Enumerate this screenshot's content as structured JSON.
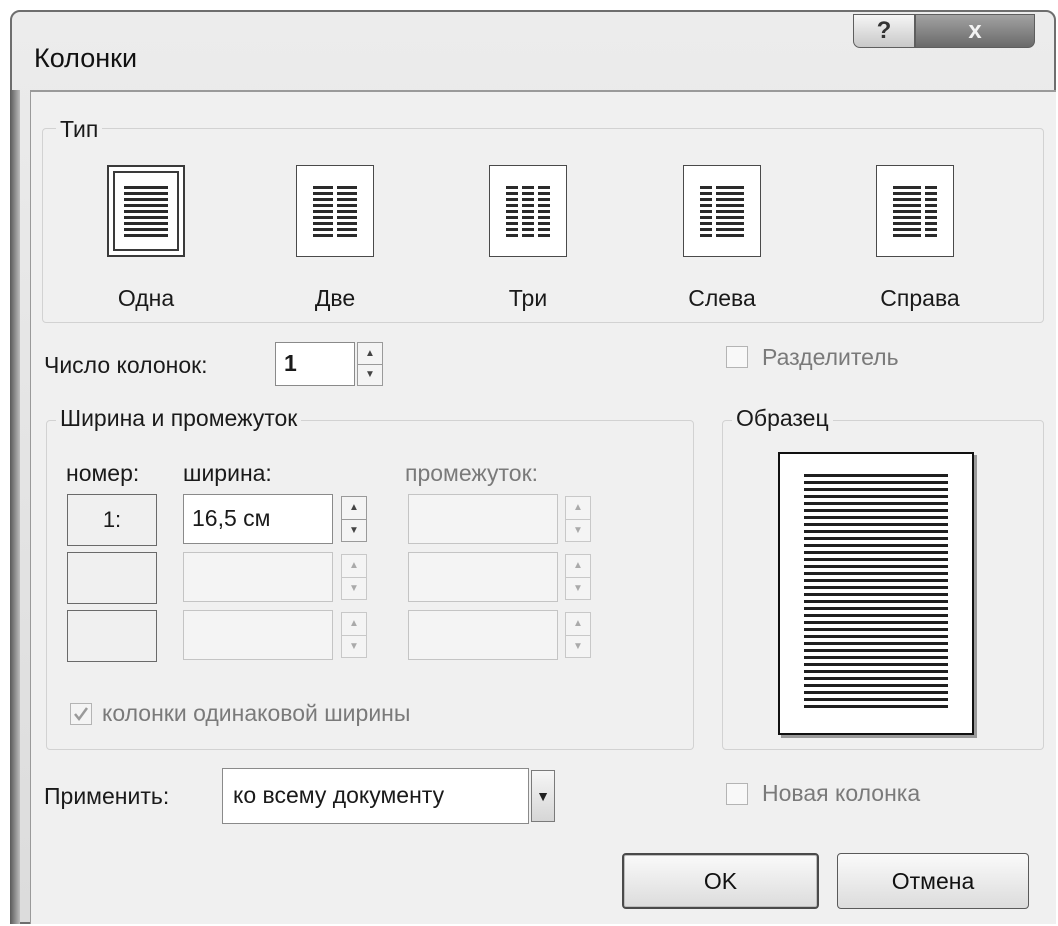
{
  "window": {
    "title": "Колонки",
    "help_glyph": "?",
    "close_glyph": "x"
  },
  "type_group": {
    "legend": "Тип",
    "options": [
      {
        "label": "Одна",
        "selected": true
      },
      {
        "label": "Две",
        "selected": false
      },
      {
        "label": "Три",
        "selected": false
      },
      {
        "label": "Слева",
        "selected": false
      },
      {
        "label": "Справа",
        "selected": false
      }
    ]
  },
  "num_columns": {
    "label": "Число колонок:",
    "value": "1"
  },
  "divider": {
    "label": "Разделитель",
    "checked": false
  },
  "width_group": {
    "legend": "Ширина и промежуток",
    "headers": {
      "number": "номер:",
      "width": "ширина:",
      "spacing": "промежуток:"
    },
    "rows": [
      {
        "number": "1:",
        "width": "16,5 см",
        "spacing": ""
      },
      {
        "number": "",
        "width": "",
        "spacing": ""
      },
      {
        "number": "",
        "width": "",
        "spacing": ""
      }
    ],
    "equal_width": {
      "label": "колонки одинаковой ширины",
      "checked": true
    }
  },
  "preview": {
    "legend": "Образец"
  },
  "apply": {
    "label": "Применить:",
    "value": "ко всему документу"
  },
  "new_column": {
    "label": "Новая колонка",
    "checked": false
  },
  "buttons": {
    "ok": "OK",
    "cancel": "Отмена"
  }
}
